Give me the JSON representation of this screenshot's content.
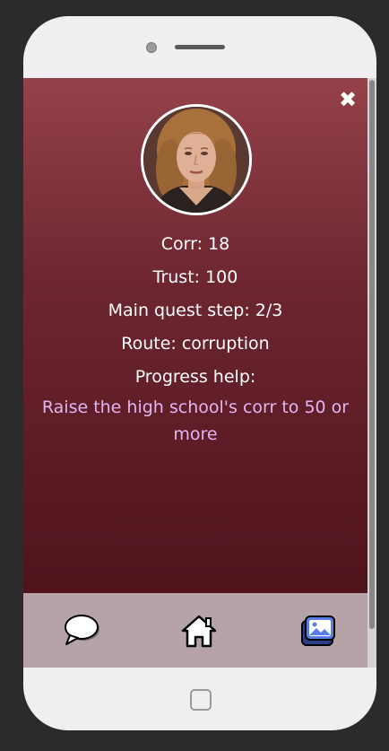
{
  "character": {
    "portrait_icon": "woman-portrait",
    "stats": [
      {
        "label": "Corr: 18"
      },
      {
        "label": "Trust: 100"
      },
      {
        "label": "Main quest step: 2/3"
      },
      {
        "label": "Route: corruption"
      },
      {
        "label": "Progress help:"
      }
    ],
    "progress_help": "Raise the high school's corr to 50 or more"
  },
  "close": {
    "symbol": "✖",
    "icon": "close-icon"
  },
  "nav": {
    "items": [
      {
        "icon": "chat-icon"
      },
      {
        "icon": "home-icon"
      },
      {
        "icon": "gallery-icon"
      }
    ]
  },
  "colors": {
    "screen_top": "#95414a",
    "screen_bottom": "#4f131c",
    "help_text": "#e2b4f2",
    "nav_bg": "#b5a3a7",
    "gallery_accent": "#5b7ee6"
  }
}
